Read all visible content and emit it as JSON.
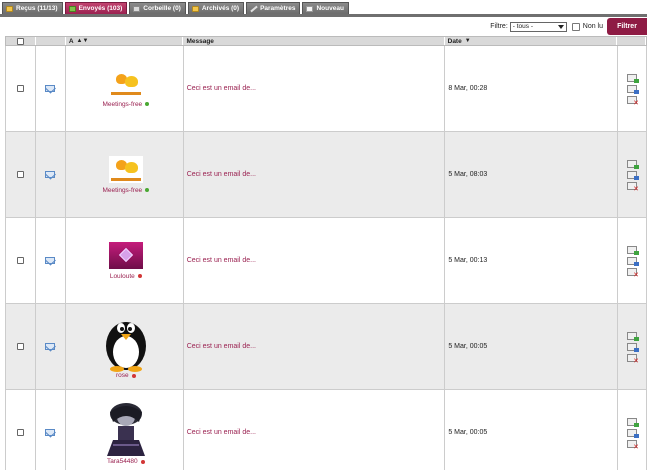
{
  "tabs": [
    {
      "label": "Reçus (11/13)",
      "icon": "folder-icon",
      "active": false
    },
    {
      "label": "Envoyés (103)",
      "icon": "sent-folder-icon",
      "active": true
    },
    {
      "label": "Corbeille (0)",
      "icon": "trash-icon",
      "active": false
    },
    {
      "label": "Archivés (0)",
      "icon": "archive-folder-icon",
      "active": false
    },
    {
      "label": "Paramètres",
      "icon": "wrench-icon",
      "active": false
    },
    {
      "label": "Nouveau",
      "icon": "envelope-icon",
      "active": false
    }
  ],
  "filter": {
    "label": "Filtre:",
    "selected": "- tous -",
    "unread_label": "Non lu",
    "button_label": "Filtrer"
  },
  "table": {
    "headers": {
      "to": "A",
      "message": "Message",
      "date": "Date"
    },
    "rows": [
      {
        "user": "Meetings-free",
        "online": true,
        "message": "Ceci est un email de...",
        "date": "8 Mar, 00:28",
        "avatar": "meetings-free-logo"
      },
      {
        "user": "Meetings-free",
        "online": true,
        "message": "Ceci est un email de...",
        "date": "5 Mar, 08:03",
        "avatar": "meetings-free-logo"
      },
      {
        "user": "Louloute",
        "online": false,
        "message": "Ceci est un email de...",
        "date": "5 Mar, 00:13",
        "avatar": "pink-gem-avatar"
      },
      {
        "user": "rose",
        "online": false,
        "message": "Ceci est un email de...",
        "date": "5 Mar, 00:05",
        "avatar": "penguin-avatar"
      },
      {
        "user": "Tara54480",
        "online": false,
        "message": "Ceci est un email de...",
        "date": "5 Mar, 00:05",
        "avatar": "gothic-girl-avatar"
      }
    ]
  },
  "colors": {
    "accent": "#9a2150",
    "button": "#8e1b44",
    "online": "#4aa832",
    "offline": "#d23636"
  }
}
